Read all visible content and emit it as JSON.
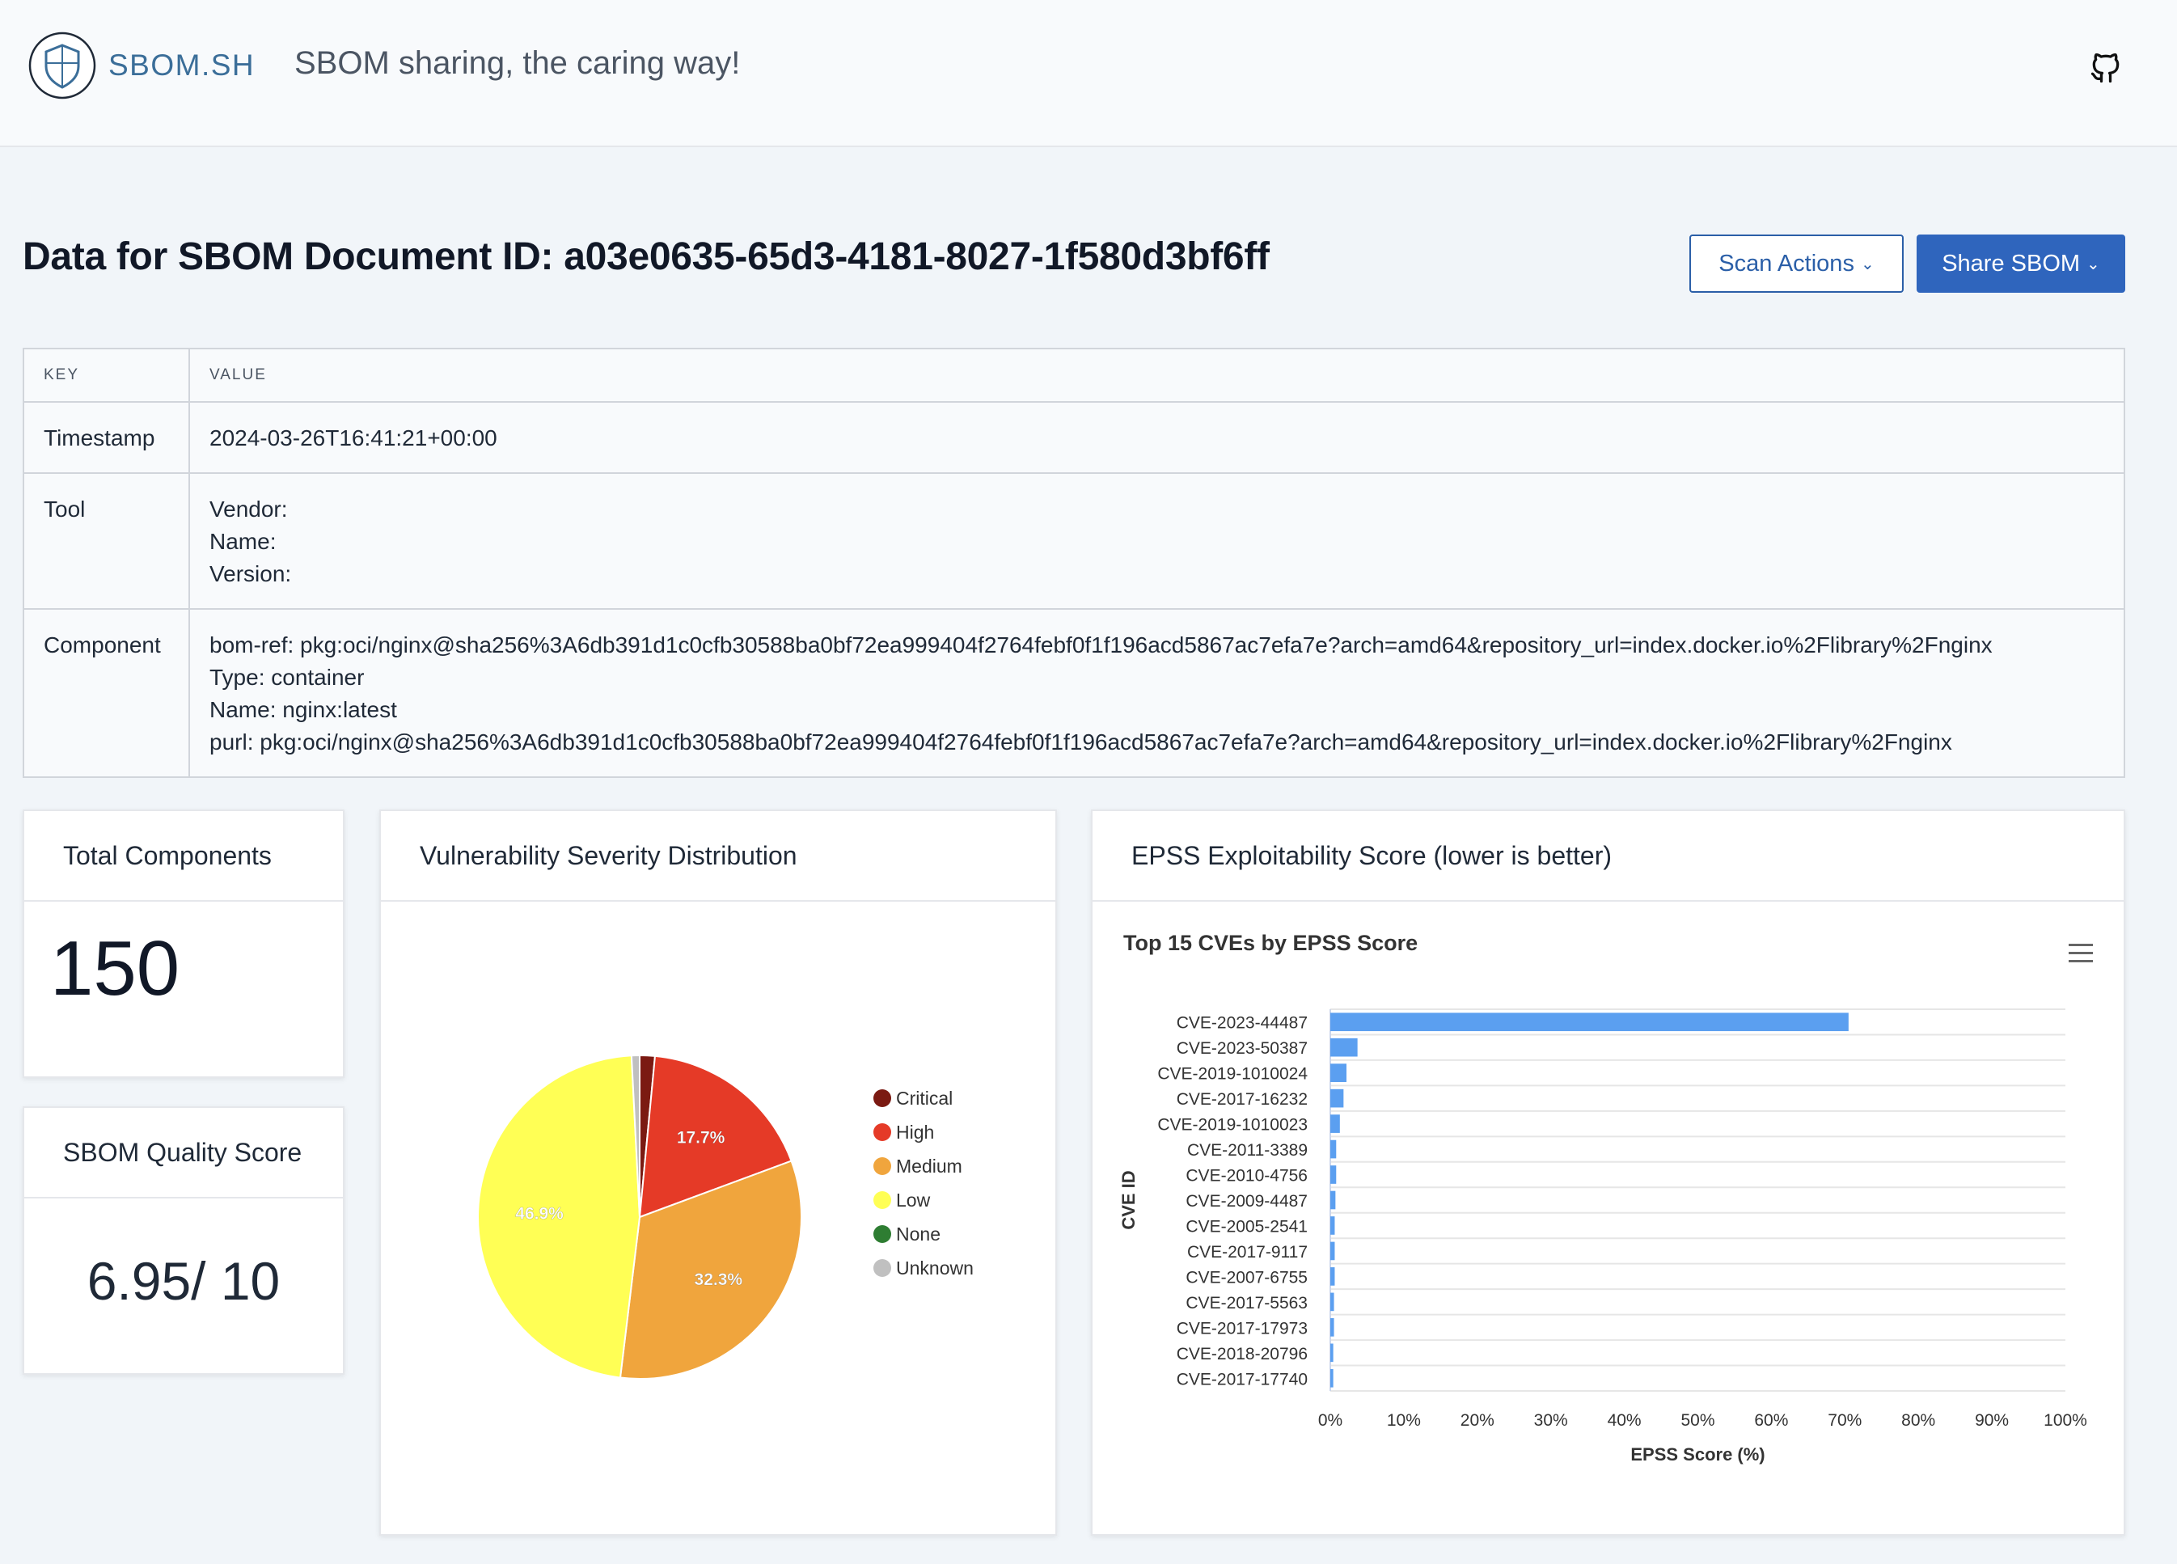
{
  "header": {
    "brand": "SBOM.SH",
    "tagline": "SBOM sharing, the caring way!"
  },
  "page": {
    "title": "Data for SBOM Document ID: a03e0635-65d3-4181-8027-1f580d3bf6ff",
    "scan_actions_label": "Scan Actions",
    "share_label": "Share SBOM"
  },
  "table": {
    "col_key": "KEY",
    "col_value": "VALUE",
    "timestamp_key": "Timestamp",
    "timestamp_value": "2024-03-26T16:41:21+00:00",
    "tool_key": "Tool",
    "tool_lines": [
      "Vendor:",
      "Name:",
      "Version:"
    ],
    "component_key": "Component",
    "component_lines": [
      "bom-ref: pkg:oci/nginx@sha256%3A6db391d1c0cfb30588ba0bf72ea999404f2764febf0f1f196acd5867ac7efa7e?arch=amd64&repository_url=index.docker.io%2Flibrary%2Fnginx",
      "Type: container",
      "Name: nginx:latest",
      "purl: pkg:oci/nginx@sha256%3A6db391d1c0cfb30588ba0bf72ea999404f2764febf0f1f196acd5867ac7efa7e?arch=amd64&repository_url=index.docker.io%2Flibrary%2Fnginx"
    ]
  },
  "cards": {
    "total_components_title": "Total Components",
    "total_components_value": "150",
    "quality_title": "SBOM Quality Score",
    "quality_value": "6.95/ 10",
    "severity_title": "Vulnerability Severity Distribution",
    "epss_title": "EPSS Exploitability Score (lower is better)"
  },
  "chart_data": [
    {
      "type": "pie",
      "title": "",
      "categories": [
        "Critical",
        "High",
        "Medium",
        "Low",
        "None",
        "Unknown"
      ],
      "values": [
        1.5,
        17.7,
        32.3,
        46.9,
        0,
        0.8
      ],
      "labels": [
        "",
        "17.7%",
        "32.3%",
        "46.9%",
        "",
        ""
      ],
      "colors": [
        "#7b1a12",
        "#e53a27",
        "#f0a53d",
        "#ffff55",
        "#2e7d32",
        "#c0c0c0"
      ],
      "legend": "right"
    },
    {
      "type": "bar",
      "orientation": "horizontal",
      "title": "Top 15 CVEs by EPSS Score",
      "xlabel": "EPSS Score (%)",
      "ylabel": "CVE ID",
      "xlim": [
        0,
        100
      ],
      "xticks": [
        "0%",
        "10%",
        "20%",
        "30%",
        "40%",
        "50%",
        "60%",
        "70%",
        "80%",
        "90%",
        "100%"
      ],
      "categories": [
        "CVE-2023-44487",
        "CVE-2023-50387",
        "CVE-2019-1010024",
        "CVE-2017-16232",
        "CVE-2019-1010023",
        "CVE-2011-3389",
        "CVE-2010-4756",
        "CVE-2009-4487",
        "CVE-2005-2541",
        "CVE-2017-9117",
        "CVE-2007-6755",
        "CVE-2017-5563",
        "CVE-2017-17973",
        "CVE-2018-20796",
        "CVE-2017-17740"
      ],
      "values": [
        70.5,
        3.7,
        2.2,
        1.8,
        1.3,
        0.8,
        0.8,
        0.7,
        0.6,
        0.6,
        0.6,
        0.5,
        0.5,
        0.4,
        0.4
      ],
      "color": "#5b9ff0",
      "grid": true
    }
  ]
}
